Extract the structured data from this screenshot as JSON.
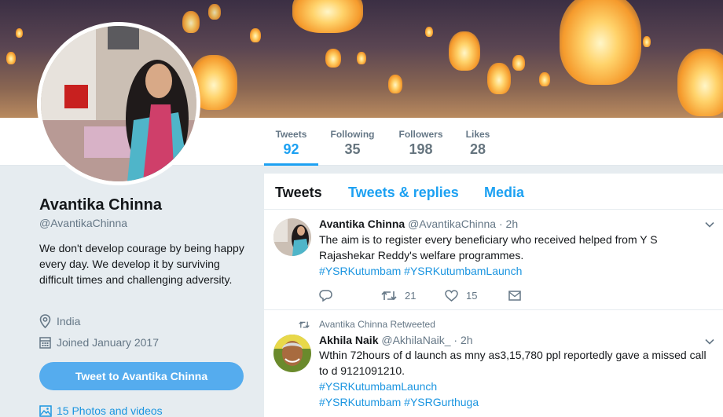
{
  "banner": {
    "lanterns": 18
  },
  "stats": [
    {
      "label": "Tweets",
      "value": "92"
    },
    {
      "label": "Following",
      "value": "35"
    },
    {
      "label": "Followers",
      "value": "198"
    },
    {
      "label": "Likes",
      "value": "28"
    }
  ],
  "profile": {
    "name": "Avantika Chinna",
    "handle": "@AvantikaChinna",
    "bio": "We don't develop courage by being happy every day. We develop it by surviving difficult times and challenging adversity.",
    "location": "India",
    "joined": "Joined January 2017",
    "tweet_to_label": "Tweet to Avantika Chinna",
    "photos_label": "15 Photos and videos"
  },
  "tabs": [
    "Tweets",
    "Tweets & replies",
    "Media"
  ],
  "tweets": [
    {
      "name": "Avantika Chinna",
      "handle": "@AvantikaChinna",
      "dot": "·",
      "time": "2h",
      "text": "The aim is to register every beneficiary who received helped from Y S Rajashekar Reddy's welfare programmes.",
      "hashtags": "#YSRKutumbam #YSRKutumbamLaunch",
      "retweets": "21",
      "likes": "15"
    },
    {
      "context": "Avantika Chinna Retweeted",
      "name": "Akhila Naik",
      "handle": "@AkhilaNaik_",
      "dot": "·",
      "time": "2h",
      "text": "Wthin 72hours of d launch as mny as3,15,780 ppl reportedly gave a missed call to d 9121091210.",
      "hashtags1": "#YSRKutumbamLaunch",
      "hashtags2": "#YSRKutumbam #YSRGurthuga"
    }
  ],
  "colors": {
    "accent": "#1da1f2",
    "link": "#1b95e0",
    "button": "#55acee",
    "bg": "#e6ecf0"
  },
  "icons": [
    "location-icon",
    "calendar-icon",
    "photo-icon",
    "reply-icon",
    "retweet-icon",
    "heart-icon",
    "message-icon",
    "chevron-down-icon"
  ]
}
